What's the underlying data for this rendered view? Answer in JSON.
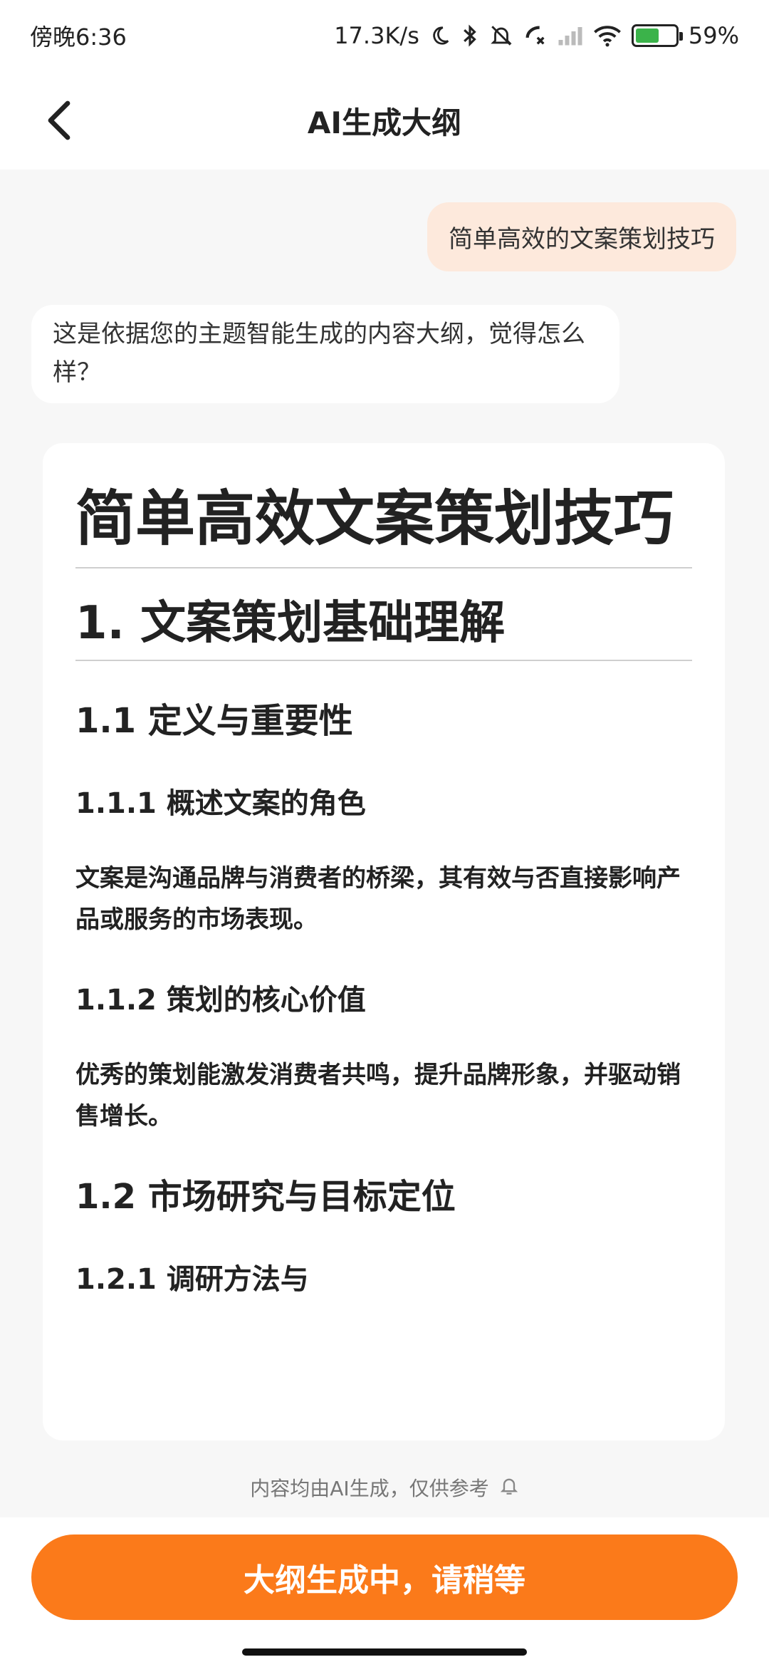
{
  "status_bar": {
    "time": "傍晚6:36",
    "net_speed": "17.3K/s",
    "battery_pct": "59%",
    "battery_level": 0.59,
    "icons": [
      "moon-icon",
      "bluetooth-icon",
      "mute-bell-icon",
      "call-icon",
      "signal-icon",
      "wifi-icon",
      "battery-icon"
    ]
  },
  "header": {
    "title": "AI生成大纲",
    "back_icon": "chevron-left-icon"
  },
  "chat": {
    "user_message": "简单高效的文案策划技巧",
    "ai_message": "这是依据您的主题智能生成的内容大纲，觉得怎么样？"
  },
  "outline": {
    "title": "简单高效文案策划技巧",
    "sections": [
      {
        "heading": "1. 文案策划基础理解"
      }
    ],
    "items": [
      {
        "level": "h2",
        "text": "1.1 定义与重要性"
      },
      {
        "level": "h3",
        "text": "1.1.1 概述文案的角色"
      },
      {
        "level": "p",
        "text": "文案是沟通品牌与消费者的桥梁，其有效与否直接影响产品或服务的市场表现。"
      },
      {
        "level": "h3",
        "text": "1.1.2 策划的核心价值"
      },
      {
        "level": "p",
        "text": "优秀的策划能激发消费者共鸣，提升品牌形象，并驱动销售增长。"
      },
      {
        "level": "h2",
        "text": "1.2 市场研究与目标定位"
      },
      {
        "level": "h3",
        "text": "1.2.1 调研方法与"
      }
    ]
  },
  "disclaimer": "内容均由AI生成，仅供参考",
  "disclaimer_icon": "bell-feedback-icon",
  "bottom_button": "大纲生成中，请稍等",
  "colors": {
    "accent": "#fb7a1a",
    "user_bubble": "#fde9dc",
    "battery": "#3bb34a"
  }
}
